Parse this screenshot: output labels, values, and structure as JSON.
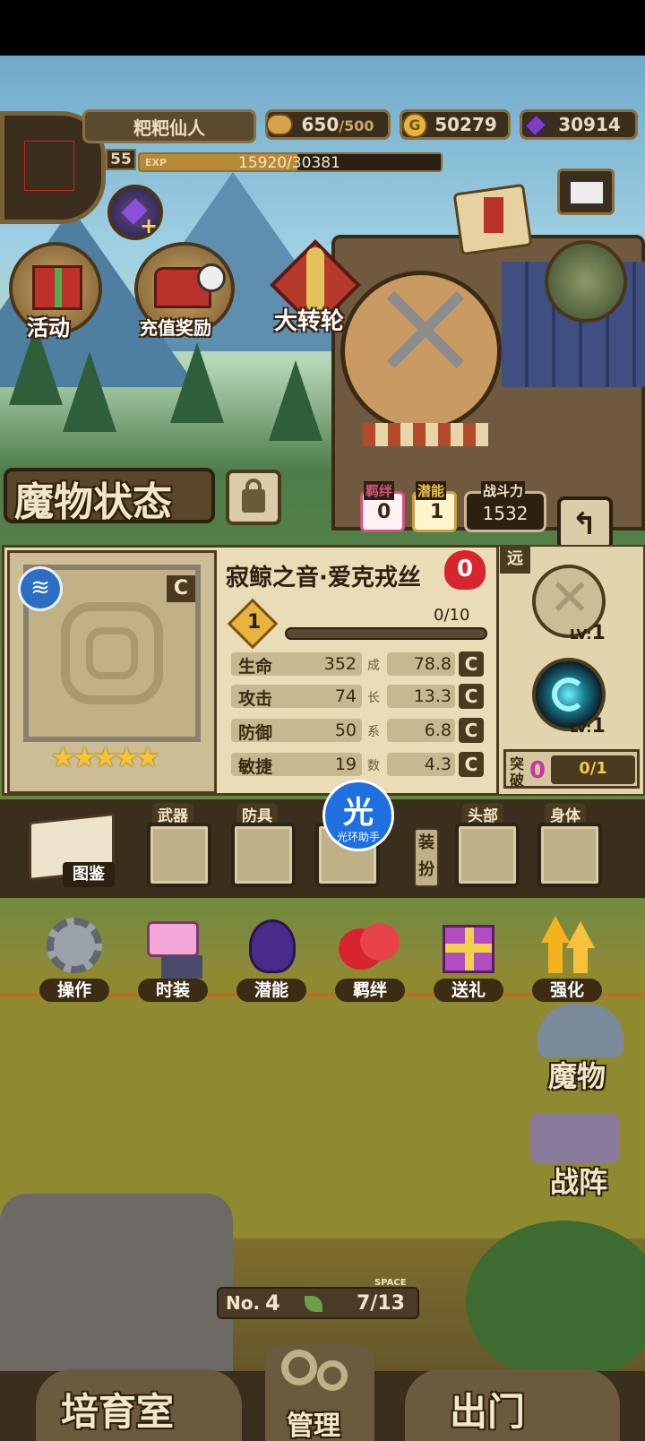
{
  "player": {
    "name": "粑粑仙人",
    "level": "55",
    "exp_label": "EXP",
    "exp": "15920/30381",
    "exp_progress": 0.524
  },
  "resources": {
    "stamina": "650",
    "stamina_max": "/500",
    "gold": "50279",
    "gems": "30914"
  },
  "top_buttons": {
    "event": "活动",
    "recharge": "充值奖励",
    "wheel": "大转轮"
  },
  "page": {
    "title": "魔物状态"
  },
  "badges": {
    "bond_label": "羁绊",
    "bond_value": "0",
    "potential_label": "潜能",
    "potential_value": "1",
    "power_label": "战斗力",
    "power_value": "1532"
  },
  "monster": {
    "name": "寂鲸之音·爱克戎丝",
    "hearts": "0",
    "stars": 5,
    "rank": "1",
    "progress_text": "0/10",
    "progress": 0,
    "element_icon": "water-element-icon",
    "range_tag": "远",
    "stats": [
      {
        "name": "生命",
        "value": "352",
        "growth": "78.8"
      },
      {
        "name": "攻击",
        "value": "74",
        "growth": "13.3"
      },
      {
        "name": "防御",
        "value": "50",
        "growth": "6.8"
      },
      {
        "name": "敏捷",
        "value": "19",
        "growth": "4.3"
      }
    ],
    "growth_label": [
      "成",
      "长",
      "系",
      "数"
    ],
    "c_label": "C",
    "skills": [
      {
        "lv": "LV:",
        "num": "1"
      },
      {
        "lv": "LV:",
        "num": "1"
      }
    ],
    "breakthrough_label_1": "突",
    "breakthrough_label_2": "破",
    "breakthrough_value": "0",
    "breakthrough_progress": "0/1"
  },
  "equipment": {
    "catalog": "图鉴",
    "weapon": "武器",
    "armor": "防具",
    "dress_up": [
      "装",
      "扮"
    ],
    "head": "头部",
    "body": "身体"
  },
  "overlay": {
    "badge_char": "光",
    "badge_text": "光环助手"
  },
  "features": [
    {
      "label": "操作",
      "icon": "gear-icon"
    },
    {
      "label": "时装",
      "icon": "outfit-icon"
    },
    {
      "label": "潜能",
      "icon": "demon-icon"
    },
    {
      "label": "羁绊",
      "icon": "hearts-icon"
    },
    {
      "label": "送礼",
      "icon": "gift-icon"
    },
    {
      "label": "强化",
      "icon": "upgrade-arrows-icon"
    }
  ],
  "side_buttons": {
    "monsters": "魔物",
    "formation": "战阵"
  },
  "base": {
    "no_label": "No.",
    "no_value": "4",
    "space_label": "SPACE",
    "space_value": "7/13"
  },
  "bottom_nav": {
    "nursery": "培育室",
    "manage": "管理",
    "exit": "出门"
  },
  "colors": {
    "panel": "#e9dcb6",
    "frame": "#4d3b1e",
    "gold": "#e7b53c",
    "heart": "#d8242e",
    "gem": "#7b3fc4"
  }
}
